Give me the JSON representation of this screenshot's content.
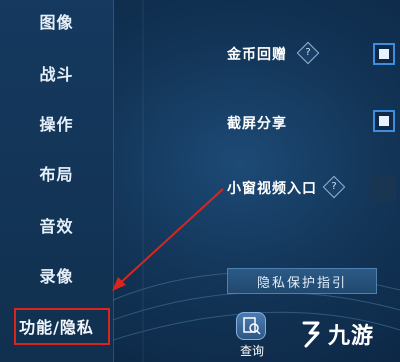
{
  "sidebar": {
    "items": [
      {
        "label": "图像"
      },
      {
        "label": "战斗"
      },
      {
        "label": "操作"
      },
      {
        "label": "布局"
      },
      {
        "label": "音效"
      },
      {
        "label": "录像"
      },
      {
        "label": "功能/隐私"
      }
    ],
    "active_index": 6
  },
  "settings": {
    "rows": [
      {
        "label": "金币回赠",
        "help": "?",
        "checked": true
      },
      {
        "label": "截屏分享",
        "checked": true
      },
      {
        "label": "小窗视频入口",
        "help": "?",
        "checked": false
      }
    ]
  },
  "privacy_guide_button": {
    "label": "隐私保护指引"
  },
  "query": {
    "label": "查询"
  },
  "watermark": {
    "text": "九游"
  },
  "colors": {
    "highlight_border": "#d8261f",
    "checkbox_border": "#3d8ee0",
    "annotation_arrow": "#d8261f"
  }
}
